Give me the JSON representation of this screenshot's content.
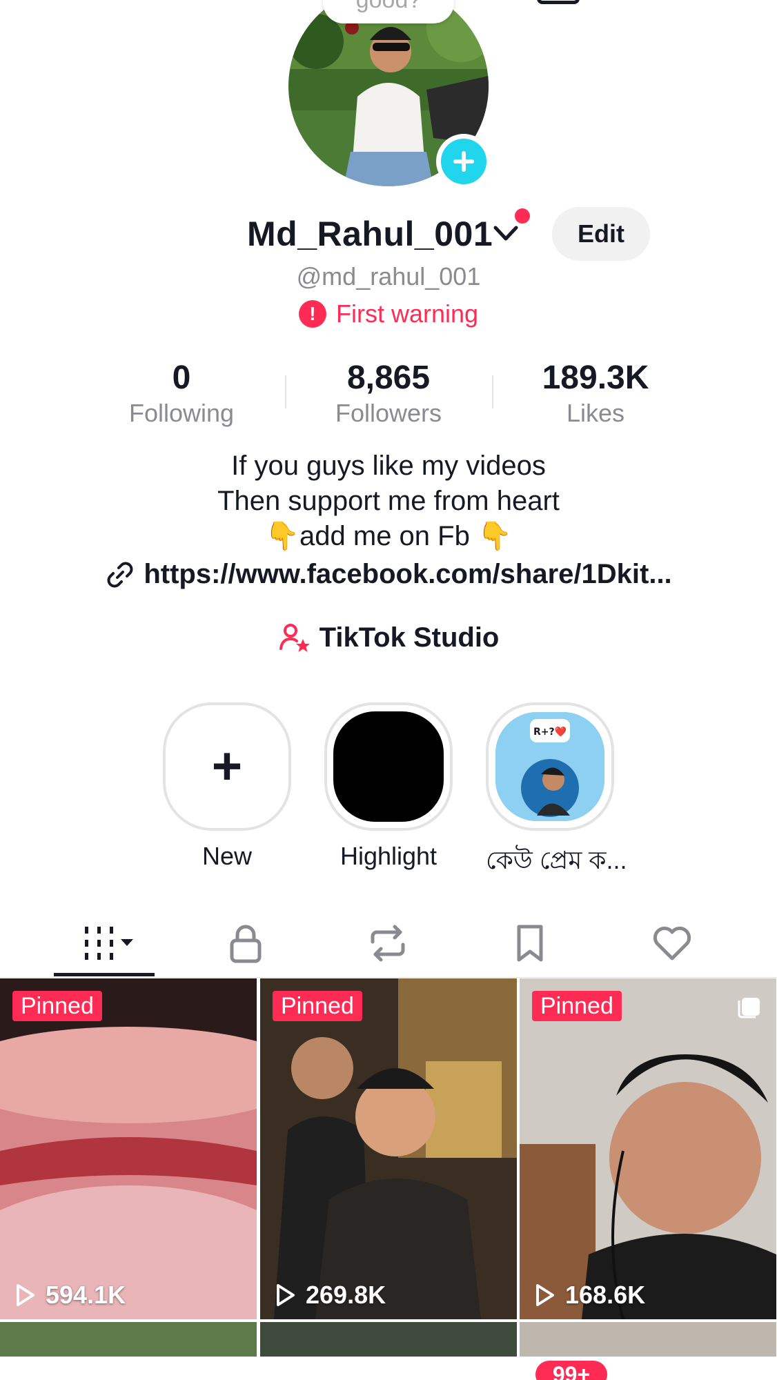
{
  "profile": {
    "note": "good?",
    "display_name": "Md_Rahul_001",
    "handle": "@md_rahul_001",
    "warning": "First warning",
    "edit_label": "Edit"
  },
  "stats": [
    {
      "value": "0",
      "label": "Following"
    },
    {
      "value": "8,865",
      "label": "Followers"
    },
    {
      "value": "189.3K",
      "label": "Likes"
    }
  ],
  "bio": {
    "line1": "If you guys like my videos",
    "line2": "Then support me from heart",
    "line3": "👇add me on Fb 👇",
    "link": "https://www.facebook.com/share/1Dkit..."
  },
  "studio_label": "TikTok Studio",
  "highlights": [
    {
      "label": "New"
    },
    {
      "label": "Highlight"
    },
    {
      "label": "কেউ প্রেম ক...",
      "bubble": "R+?❤️"
    }
  ],
  "tabs": [
    {
      "icon": "grid-icon",
      "active": true
    },
    {
      "icon": "lock-icon"
    },
    {
      "icon": "repost-icon"
    },
    {
      "icon": "bookmark-icon"
    },
    {
      "icon": "heart-icon"
    }
  ],
  "videos": [
    {
      "badge": "Pinned",
      "views": "594.1K"
    },
    {
      "badge": "Pinned",
      "views": "269.8K"
    },
    {
      "badge": "Pinned",
      "views": "168.6K"
    }
  ],
  "bottom_nav": {
    "inbox_badge": "99+"
  },
  "colors": {
    "accent": "#fe2c55",
    "cyan": "#20d5ec",
    "text": "#161823",
    "muted": "#8a8b91"
  }
}
